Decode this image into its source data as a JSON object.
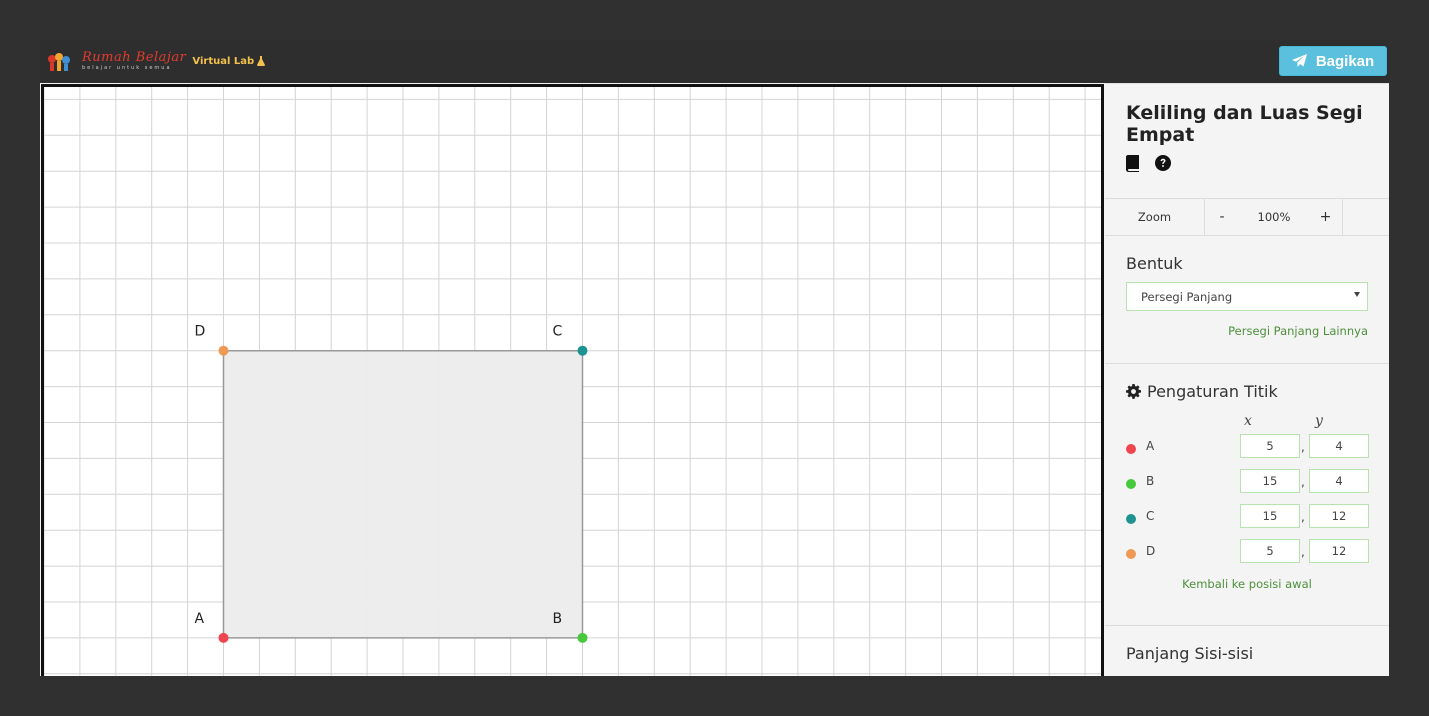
{
  "header": {
    "logo_name": "Rumah Belajar",
    "logo_tagline": "belajar untuk semua",
    "logo_product": "Virtual Lab",
    "share_label": "Bagikan"
  },
  "canvas": {
    "points": [
      {
        "name": "A",
        "x": 5,
        "y": 4,
        "color": "#f0454e"
      },
      {
        "name": "B",
        "x": 15,
        "y": 4,
        "color": "#46c93a"
      },
      {
        "name": "C",
        "x": 15,
        "y": 12,
        "color": "#1e9492"
      },
      {
        "name": "D",
        "x": 5,
        "y": 12,
        "color": "#ee9a55"
      }
    ],
    "shape_fill": "#ececec",
    "shape_stroke": "#999999",
    "grid_color": "#d4d4d4"
  },
  "panel": {
    "title": "Keliling dan Luas Segi Empat",
    "icons": [
      "book-icon",
      "help-icon"
    ],
    "zoom": {
      "label": "Zoom",
      "minus": "-",
      "value": "100%",
      "plus": "+"
    },
    "shape": {
      "heading": "Bentuk",
      "selected": "Persegi Panjang",
      "other_link": "Persegi Panjang Lainnya"
    },
    "points_settings": {
      "heading": "Pengaturan Titik",
      "x_label": "x",
      "y_label": "y",
      "reset_link": "Kembali ke posisi awal"
    },
    "sides": {
      "heading": "Panjang Sisi-sisi"
    }
  }
}
